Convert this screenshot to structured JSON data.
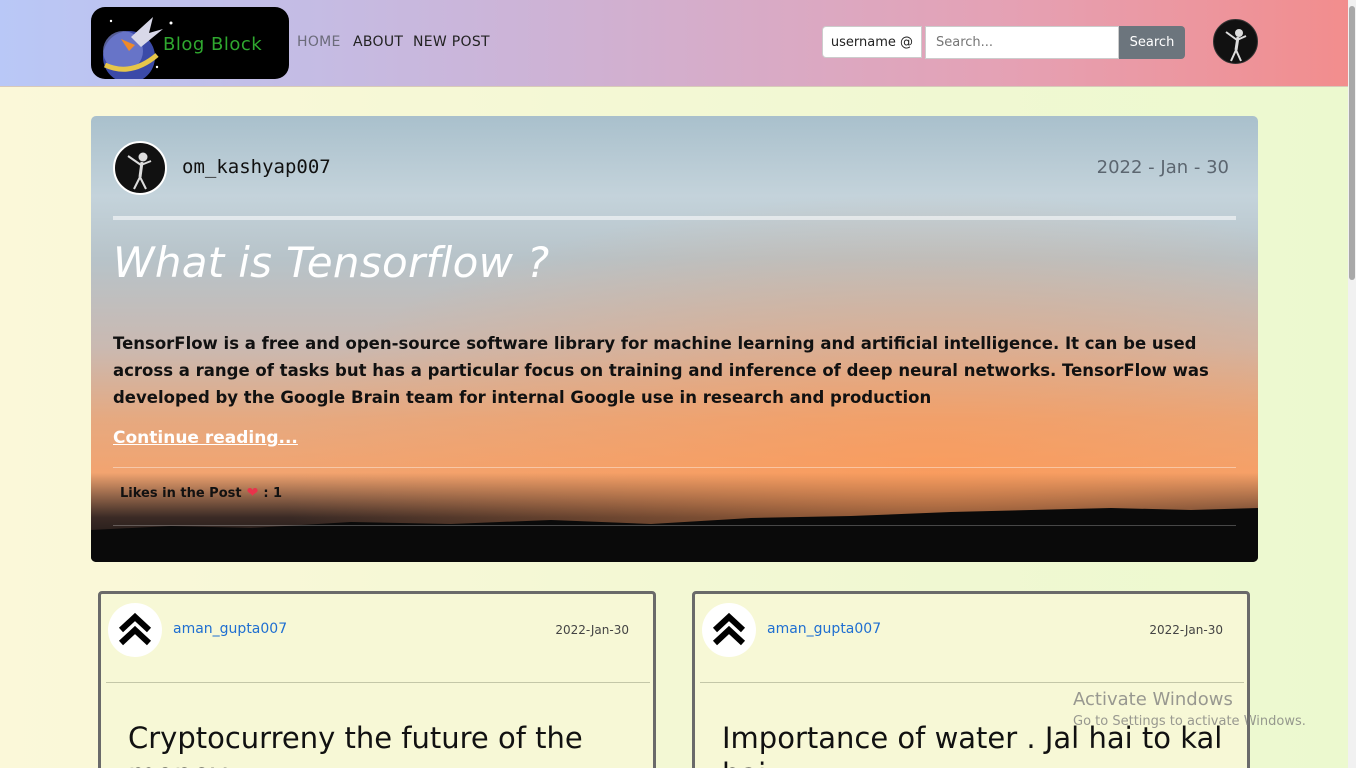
{
  "navbar": {
    "logo_text": "Blog Block",
    "links": [
      {
        "label": "HOME"
      },
      {
        "label": "ABOUT"
      },
      {
        "label": "NEW POST"
      }
    ],
    "search_scope": "username @",
    "search_placeholder": "Search...",
    "search_button": "Search"
  },
  "hero": {
    "username": "om_kashyap007",
    "date": "2022 - Jan - 30",
    "title": "What is Tensorflow ?",
    "body": "TensorFlow is a free and open-source software library for machine learning and artificial intelligence. It can be used across a range of tasks but has a particular focus on training and inference of deep neural networks. TensorFlow was developed by the Google Brain team for internal Google use in research and production",
    "link": "Continue reading...",
    "likes_label": "Likes in the Post",
    "likes_count": ": 1"
  },
  "cards": [
    {
      "username": "aman_gupta007",
      "date": "2022-Jan-30",
      "title": "Cryptocurreny the future of the money"
    },
    {
      "username": "aman_gupta007",
      "date": "2022-Jan-30",
      "title": "Importance of water . Jal hai to kal hai"
    }
  ],
  "watermark": {
    "line1": "Activate Windows",
    "line2": "Go to Settings to activate Windows."
  }
}
